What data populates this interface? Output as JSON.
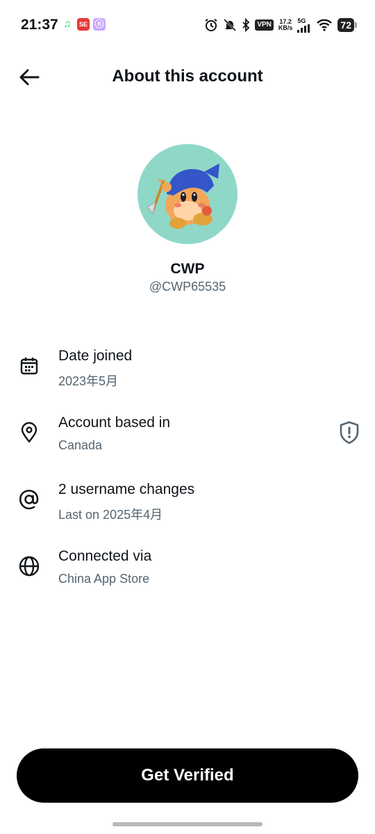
{
  "status_bar": {
    "time": "21:37",
    "app_icons": [
      {
        "name": "music-app-icon",
        "glyph": "♫",
        "color": "#2ecc71"
      },
      {
        "name": "red-app-icon",
        "glyph": "SE",
        "color": "#e53935"
      },
      {
        "name": "purple-app-icon",
        "glyph": "ⓝ",
        "color": "#b388ff"
      }
    ],
    "vpn_label": "VPN",
    "speed_value": "17.2",
    "speed_unit": "KB/s",
    "network_label": "5G",
    "battery": "72"
  },
  "header": {
    "title": "About this account",
    "back_icon": "arrow-left-icon"
  },
  "profile": {
    "display_name": "CWP",
    "handle": "@CWP65535",
    "avatar_bg": "#8fd8c8"
  },
  "info": [
    {
      "icon": "calendar-icon",
      "title": "Date joined",
      "subtitle": "2023年5月"
    },
    {
      "icon": "location-pin-icon",
      "title": "Account based in",
      "subtitle": "Canada",
      "trailing_icon": "shield-alert-icon"
    },
    {
      "icon": "at-sign-icon",
      "title": "2 username changes",
      "subtitle": "Last on 2025年4月"
    },
    {
      "icon": "globe-icon",
      "title": "Connected via",
      "subtitle": "China App Store"
    }
  ],
  "cta": {
    "label": "Get Verified",
    "bg": "#000000",
    "fg": "#ffffff"
  },
  "colors": {
    "primary_text": "#0f1419",
    "secondary_text": "#536471"
  }
}
